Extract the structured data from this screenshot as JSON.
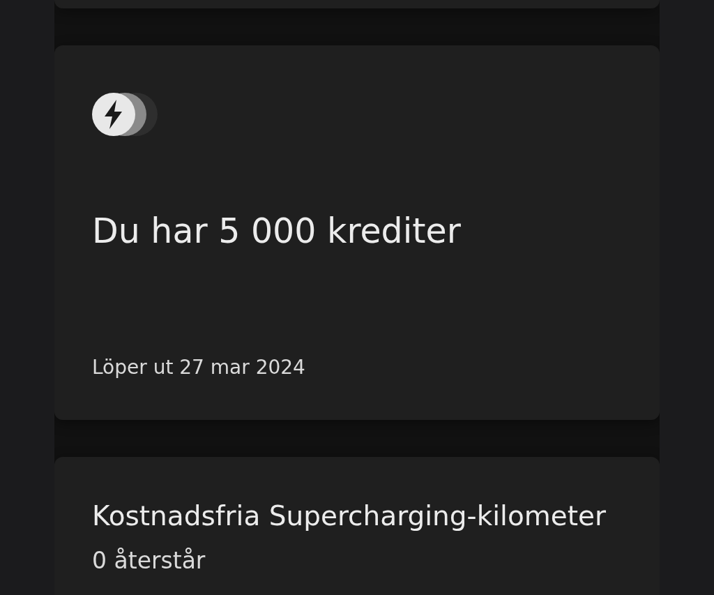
{
  "cards": [
    {
      "kind": "blank"
    },
    {
      "kind": "credits",
      "title": "Du har 5 000 krediter",
      "expiry": "Löper ut 27 mar 2024"
    },
    {
      "kind": "info",
      "title": "Kostnadsfria Supercharging-kilometer",
      "subtitle": "0 återstår"
    }
  ]
}
